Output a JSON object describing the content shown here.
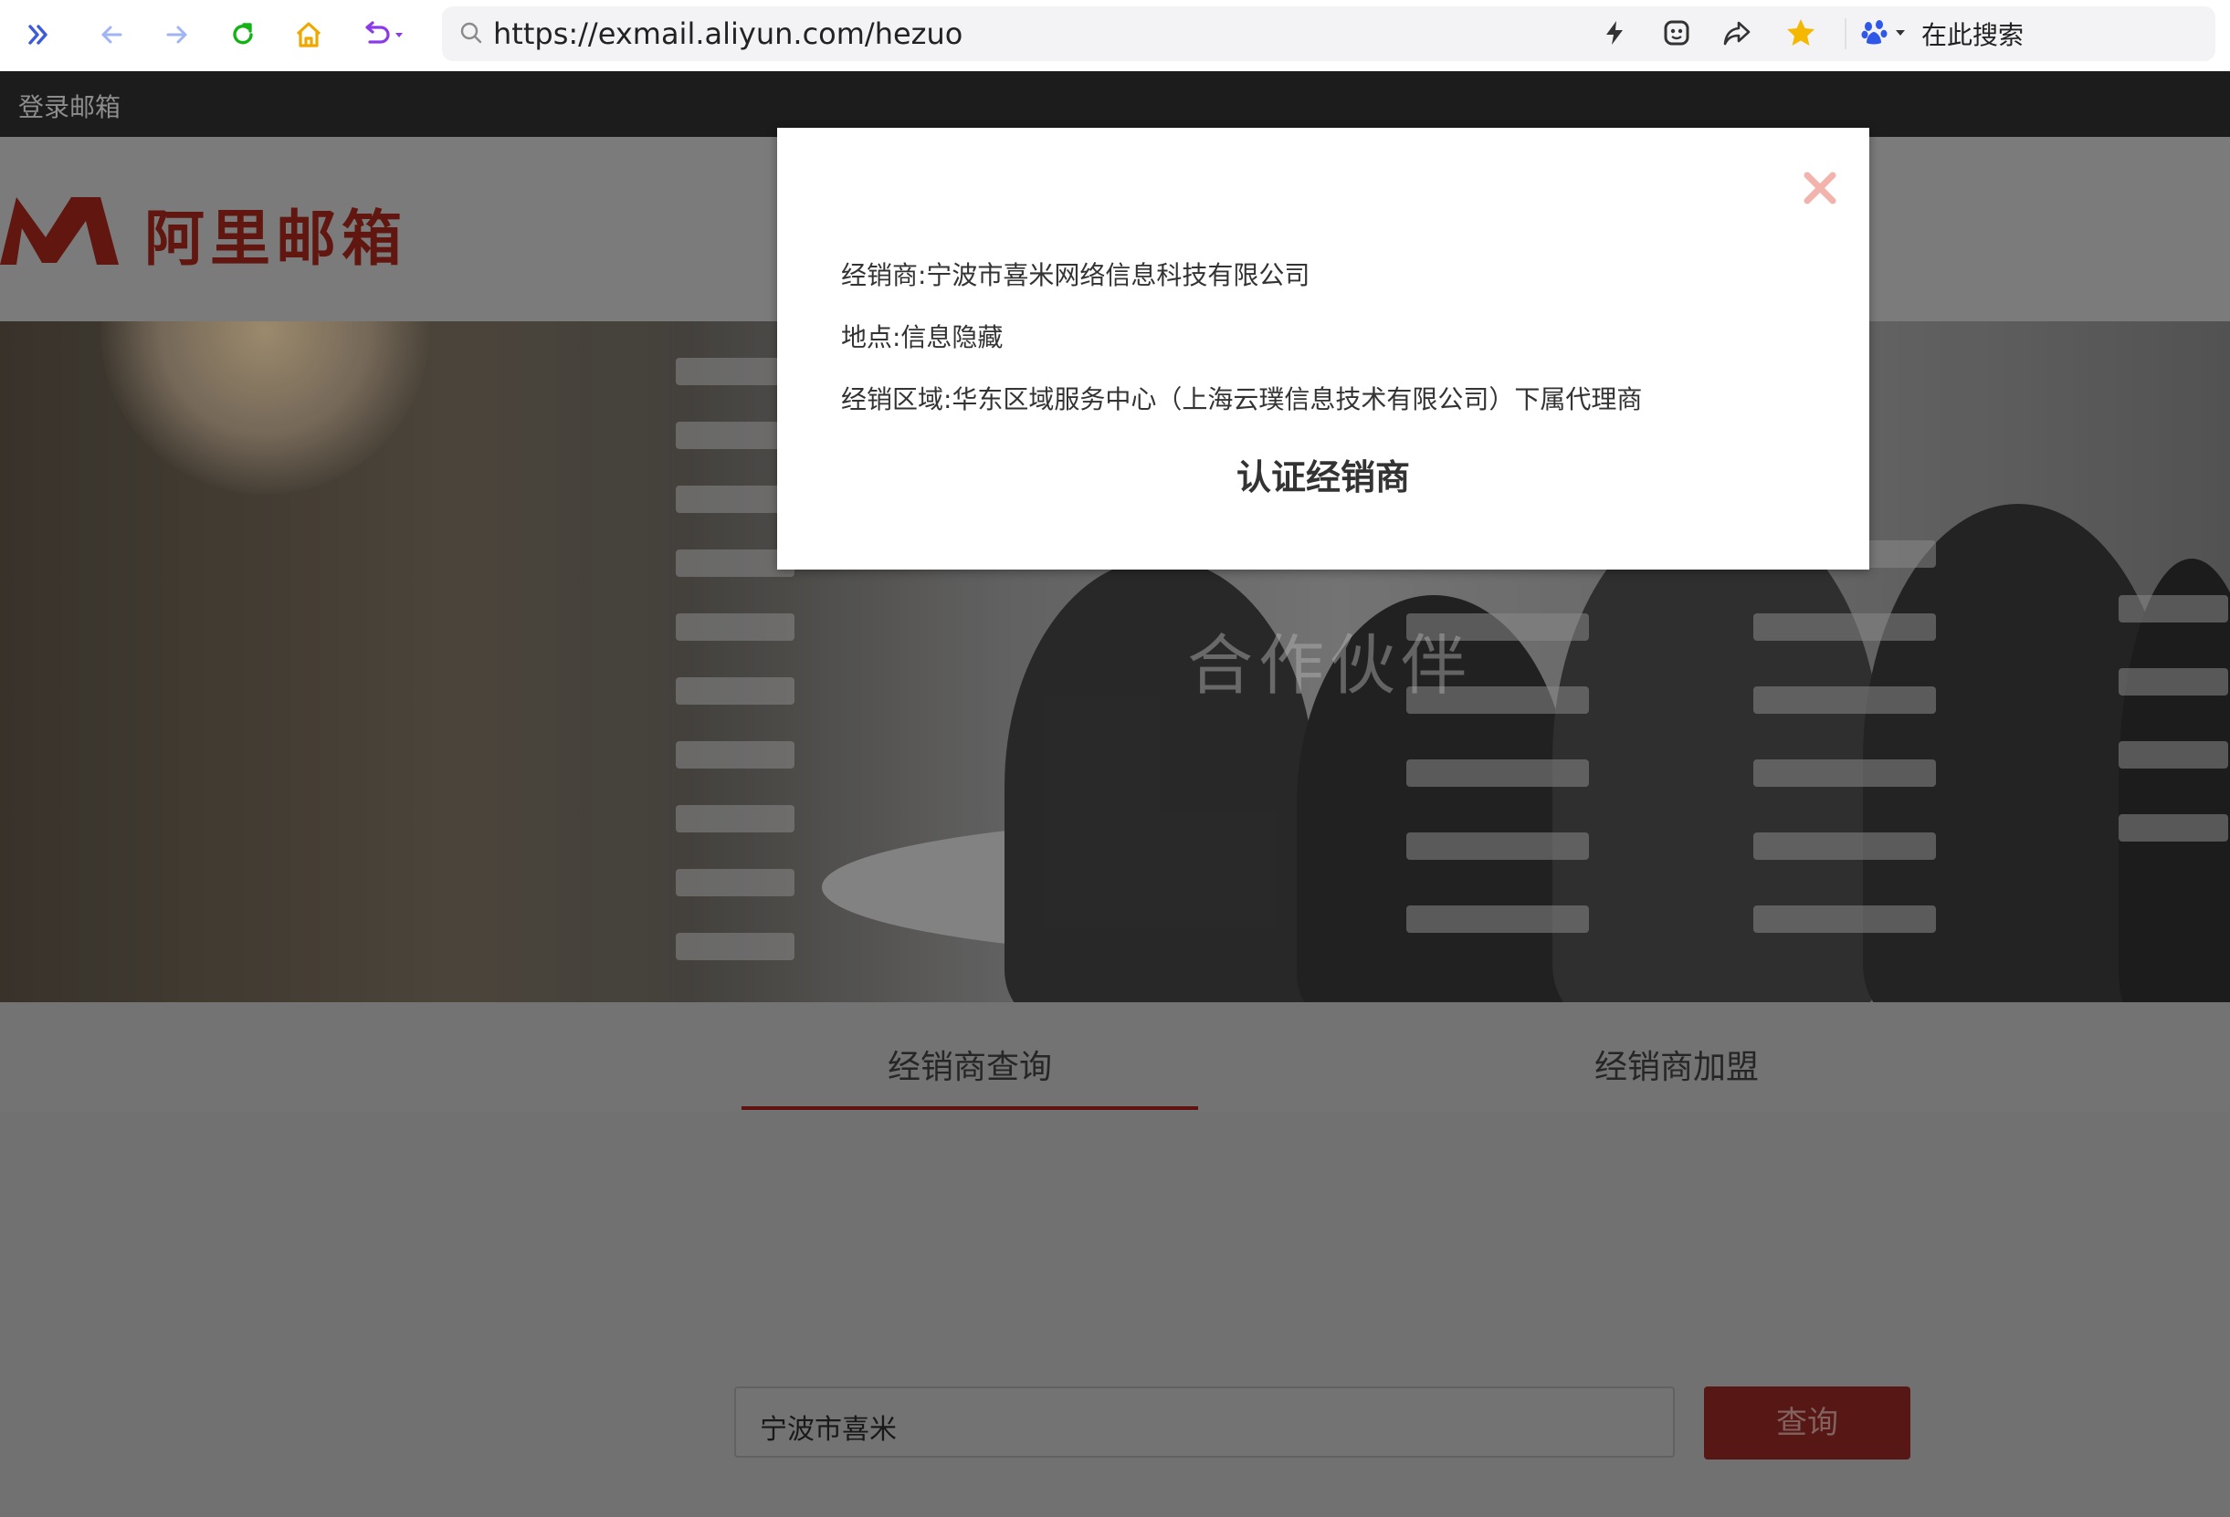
{
  "browser": {
    "url": "https://exmail.aliyun.com/hezuo",
    "search_label": "在此搜索",
    "icons": [
      "sidebar-toggle-icon",
      "back-arrow-icon",
      "forward-arrow-icon",
      "refresh-icon",
      "home-icon",
      "undo-icon",
      "search-icon",
      "lightning-icon",
      "extension-icon",
      "share-icon",
      "star-icon",
      "baidu-paw-icon"
    ],
    "colors": {
      "sidebar": "#3b5bdb",
      "refresh": "#12b312",
      "home": "#f0a800",
      "undo": "#8a3ae8",
      "star": "#f5b800"
    }
  },
  "site": {
    "login_label": "登录邮箱",
    "logo_text": "阿里邮箱",
    "hero_title": "合作伙伴",
    "brand_color": "#c0261b"
  },
  "tabs": [
    {
      "label": "经销商查询",
      "active": true
    },
    {
      "label": "经销商加盟",
      "active": false
    }
  ],
  "search": {
    "value": "宁波市喜米",
    "button_label": "查询"
  },
  "modal": {
    "dealer": "经销商:宁波市喜米网络信息科技有限公司",
    "location": "地点:信息隐藏",
    "region": "经销区域:华东区域服务中心（上海云璞信息技术有限公司）下属代理商",
    "title": "认证经销商"
  }
}
